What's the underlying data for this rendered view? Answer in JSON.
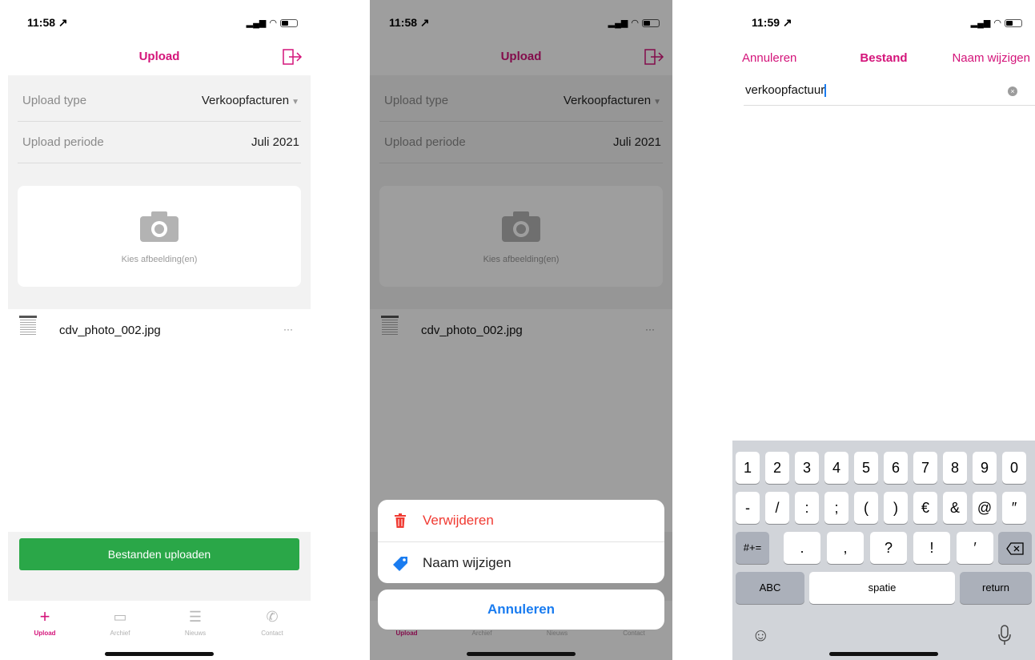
{
  "screen1": {
    "status_time": "11:58 ↗",
    "nav_title": "Upload",
    "upload_type_label": "Upload type",
    "upload_type_value": "Verkoopfacturen",
    "upload_period_label": "Upload periode",
    "upload_period_value": "Juli 2021",
    "picker_label": "Kies afbeelding(en)",
    "file_name": "cdv_photo_002.jpg",
    "file_more": "···",
    "upload_button": "Bestanden uploaden",
    "tabs": [
      {
        "label": "Upload",
        "icon": "plus-icon",
        "active": true
      },
      {
        "label": "Archief",
        "icon": "archive-icon",
        "active": false
      },
      {
        "label": "Nieuws",
        "icon": "news-icon",
        "active": false
      },
      {
        "label": "Contact",
        "icon": "phone-icon",
        "active": false
      }
    ]
  },
  "screen2": {
    "status_time": "11:58 ↗",
    "nav_title": "Upload",
    "upload_type_label": "Upload type",
    "upload_type_value": "Verkoopfacturen",
    "upload_period_label": "Upload periode",
    "upload_period_value": "Juli 2021",
    "picker_label": "Kies afbeelding(en)",
    "file_name": "cdv_photo_002.jpg",
    "file_more": "···",
    "action_sheet": {
      "delete_label": "Verwijderen",
      "rename_label": "Naam wijzigen",
      "cancel_label": "Annuleren"
    },
    "tabs": [
      {
        "label": "Upload"
      },
      {
        "label": "Archief"
      },
      {
        "label": "Nieuws"
      },
      {
        "label": "Contact"
      }
    ]
  },
  "screen3": {
    "status_time": "11:59 ↗",
    "cancel_label": "Annuleren",
    "title": "Bestand",
    "rename_label": "Naam wijzigen",
    "filename_value": "verkoopfactuur",
    "keyboard": {
      "row1": [
        "1",
        "2",
        "3",
        "4",
        "5",
        "6",
        "7",
        "8",
        "9",
        "0"
      ],
      "row2": [
        "-",
        "/",
        ":",
        ";",
        "(",
        ")",
        "€",
        "&",
        "@",
        "″"
      ],
      "row3_fn": "#+=",
      "row3": [
        ".",
        ",",
        "?",
        "!",
        "′"
      ],
      "abc_label": "ABC",
      "space_label": "spatie",
      "return_label": "return"
    }
  },
  "colors": {
    "accent": "#d4147a",
    "upload_button": "#2aa748",
    "delete": "#f03a32",
    "action_blue": "#1a7cf0"
  }
}
